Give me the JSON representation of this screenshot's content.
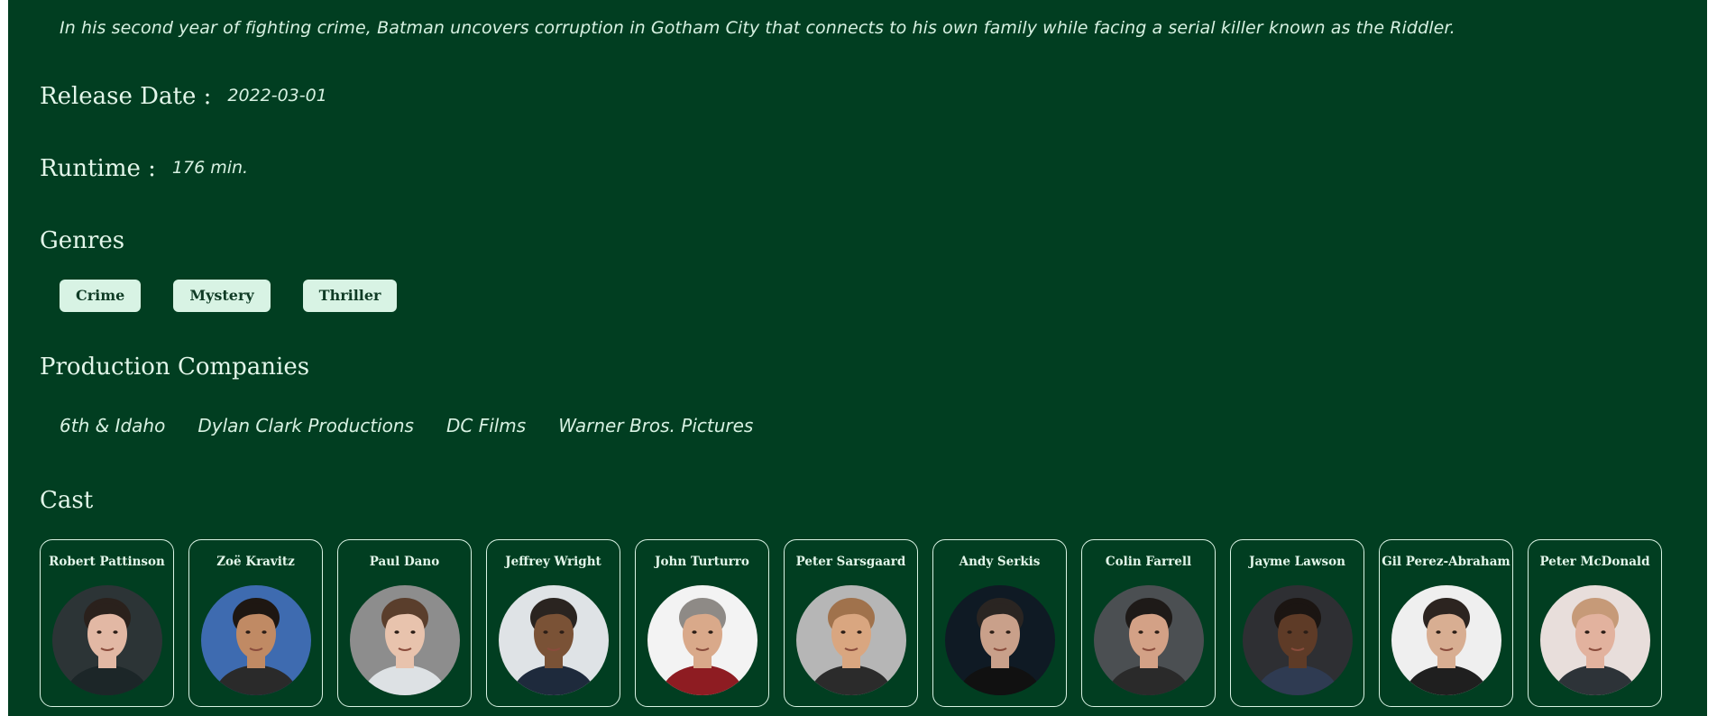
{
  "movie": {
    "overview": "In his second year of fighting crime, Batman uncovers corruption in Gotham City that connects to his own family while facing a serial killer known as the Riddler.",
    "release_label": "Release Date :",
    "release_date": "2022-03-01",
    "runtime_label": "Runtime :",
    "runtime": "176 min."
  },
  "genres": {
    "heading": "Genres",
    "items": [
      "Crime",
      "Mystery",
      "Thriller"
    ]
  },
  "companies": {
    "heading": "Production Companies",
    "items": [
      "6th & Idaho",
      "Dylan Clark Productions",
      "DC Films",
      "Warner Bros. Pictures"
    ]
  },
  "cast": {
    "heading": "Cast",
    "items": [
      {
        "name": "Robert Pattinson",
        "bg": "#2c3436",
        "skin": "#e2b8a4",
        "hair": "#2a211c",
        "shirt": "#1c2628"
      },
      {
        "name": "Zoë Kravitz",
        "bg": "#3e6bb0",
        "skin": "#c08a64",
        "hair": "#1e1712",
        "shirt": "#2a2a2a"
      },
      {
        "name": "Paul Dano",
        "bg": "#8d8d8d",
        "skin": "#e8c3ad",
        "hair": "#5a3e2c",
        "shirt": "#dde1e4"
      },
      {
        "name": "Jeffrey Wright",
        "bg": "#dfe3e6",
        "skin": "#7a5236",
        "hair": "#2a2420",
        "shirt": "#1e2a3c"
      },
      {
        "name": "John Turturro",
        "bg": "#f3f3f3",
        "skin": "#d9a98a",
        "hair": "#8e8a86",
        "shirt": "#8e1c22"
      },
      {
        "name": "Peter Sarsgaard",
        "bg": "#b6b6b6",
        "skin": "#d9a680",
        "hair": "#a0724c",
        "shirt": "#2b2b2b"
      },
      {
        "name": "Andy Serkis",
        "bg": "#0f1a24",
        "skin": "#c9a08a",
        "hair": "#2a2522",
        "shirt": "#111111"
      },
      {
        "name": "Colin Farrell",
        "bg": "#4b4f52",
        "skin": "#d3a186",
        "hair": "#1e1a18",
        "shirt": "#2a2a2a"
      },
      {
        "name": "Jayme Lawson",
        "bg": "#2e2f33",
        "skin": "#5e3b27",
        "hair": "#1b1512",
        "shirt": "#2f3b52"
      },
      {
        "name": "Gil Perez-Abraham",
        "bg": "#efefef",
        "skin": "#d8ae92",
        "hair": "#2c2420",
        "shirt": "#1f1f1f"
      },
      {
        "name": "Peter McDonald",
        "bg": "#e8dedb",
        "skin": "#e2b29e",
        "hair": "#c69a78",
        "shirt": "#2d3338"
      }
    ]
  },
  "colors": {
    "background": "#013e21",
    "text": "#d9f3e4",
    "chip_bg": "#d8f3e4",
    "chip_text": "#0f3b25"
  }
}
